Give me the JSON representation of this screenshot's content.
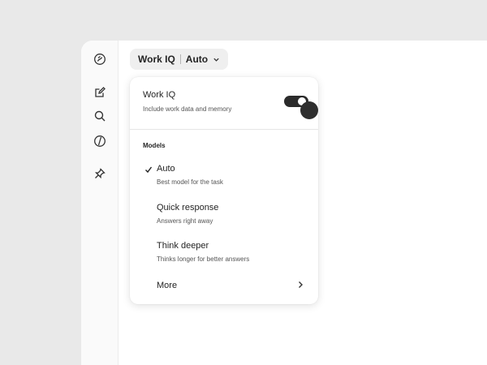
{
  "header": {
    "primary_label": "Work IQ",
    "mode_label": "Auto",
    "dropdown_icon": "chevron-down-icon"
  },
  "sidebar": {
    "icons": [
      "copilot-logo-icon",
      "new-chat-icon",
      "search-icon",
      "copilot-icon",
      "pin-icon"
    ]
  },
  "work_iq": {
    "title": "Work IQ",
    "description": "Include work data and memory",
    "enabled": true
  },
  "models": {
    "section_label": "Models",
    "items": [
      {
        "name": "Auto",
        "description": "Best model for the task",
        "selected": true
      },
      {
        "name": "Quick response",
        "description": "Answers right away",
        "selected": false
      },
      {
        "name": "Think deeper",
        "description": "Thinks longer for better answers",
        "selected": false
      }
    ],
    "more_label": "More"
  },
  "colors": {
    "background": "#e9e9e9",
    "panel": "#ffffff",
    "toggle_on": "#2b2b2b",
    "text": "#242424",
    "secondary_text": "#555555"
  }
}
